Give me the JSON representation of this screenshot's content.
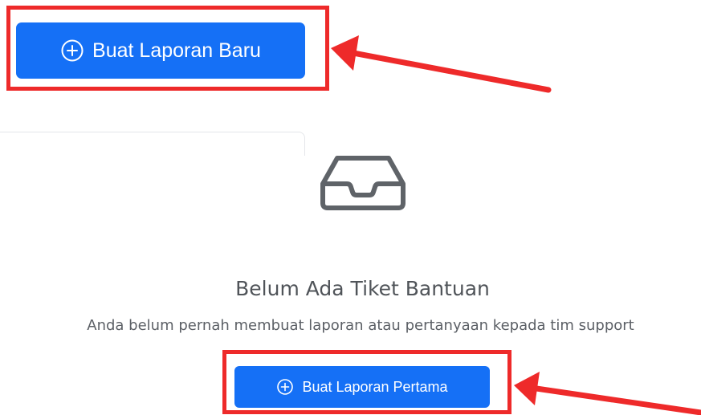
{
  "header": {
    "create_button_label": "Buat Laporan Baru"
  },
  "empty_state": {
    "title": "Belum Ada Tiket Bantuan",
    "description": "Anda belum pernah membuat laporan atau pertanyaan kepada tim support",
    "cta_label": "Buat Laporan Pertama",
    "icon": "inbox-icon"
  },
  "icons": {
    "button_icon": "plus-circle-icon"
  },
  "colors": {
    "primary": "#1570f6",
    "highlight": "#ee2a2a",
    "icon_gray": "#5f6368",
    "text": "#505459"
  }
}
